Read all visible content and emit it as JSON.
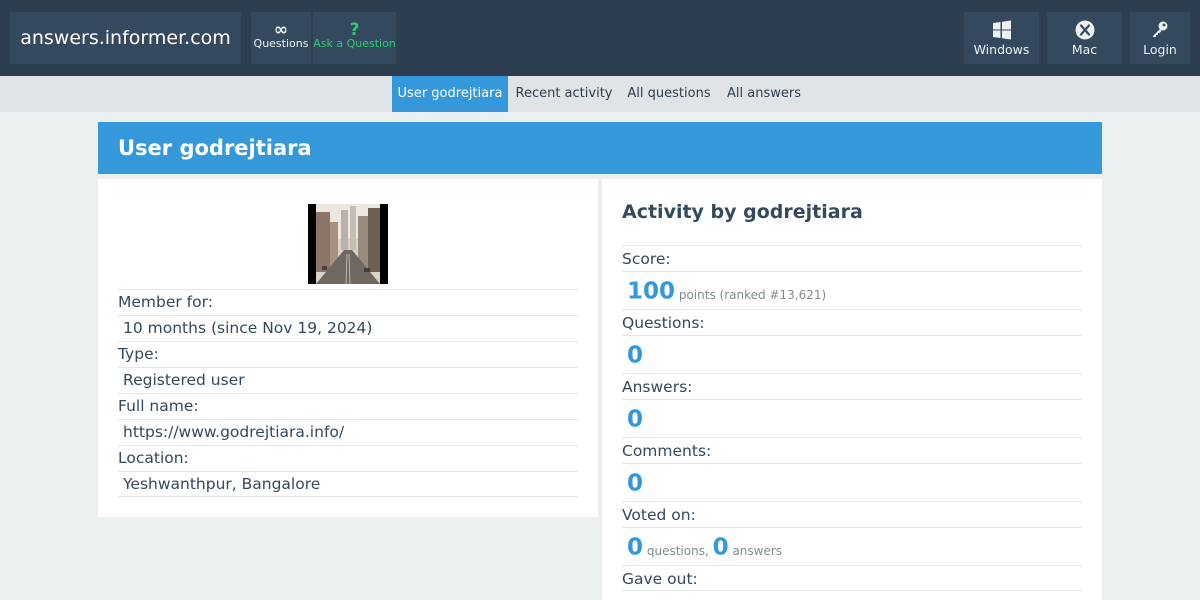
{
  "header": {
    "logo": "answers.informer.com",
    "nav": [
      {
        "icon": "infinity-icon",
        "label": "Questions"
      },
      {
        "icon": "question-mark-icon",
        "label": "Ask a Question"
      }
    ],
    "right_buttons": [
      {
        "icon": "windows-icon",
        "label": "Windows"
      },
      {
        "icon": "mac-icon",
        "label": "Mac"
      },
      {
        "icon": "key-icon",
        "label": "Login"
      }
    ],
    "ask_color": "#2ecc71"
  },
  "subnav": {
    "tabs": [
      {
        "label": "User godrejtiara",
        "active": true
      },
      {
        "label": "Recent activity",
        "active": false
      },
      {
        "label": "All questions",
        "active": false
      },
      {
        "label": "All answers",
        "active": false
      }
    ],
    "accent": "#3498db"
  },
  "page_title": "User godrejtiara",
  "profile": {
    "member_for_label": "Member for:",
    "member_for_value": "10 months (since Nov 19, 2024)",
    "type_label": "Type:",
    "type_value": "Registered user",
    "fullname_label": "Full name:",
    "fullname_value": "https://www.godrejtiara.info/",
    "location_label": "Location:",
    "location_value": "Yeshwanthpur, Bangalore"
  },
  "activity": {
    "title": "Activity by godrejtiara",
    "score_label": "Score:",
    "score_value": "100",
    "score_suffix": "points (ranked #13,621)",
    "questions_label": "Questions:",
    "questions_value": "0",
    "answers_label": "Answers:",
    "answers_value": "0",
    "comments_label": "Comments:",
    "comments_value": "0",
    "voted_label": "Voted on:",
    "voted_questions": "0",
    "voted_questions_suffix": "questions,",
    "voted_answers": "0",
    "voted_answers_suffix": "answers",
    "gave_out_label": "Gave out:"
  }
}
